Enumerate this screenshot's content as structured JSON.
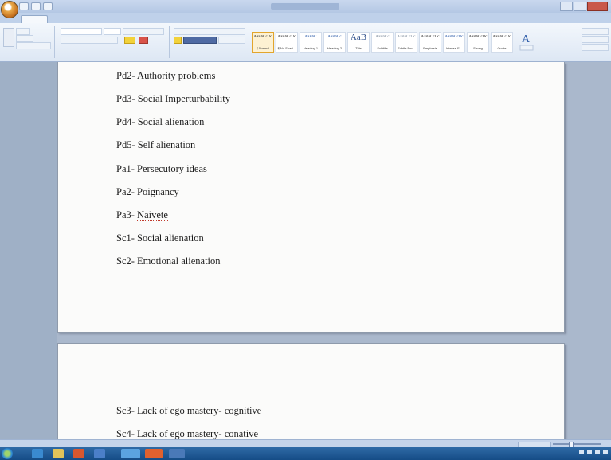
{
  "document": {
    "page1_lines": [
      "Pd2- Authority problems",
      "Pd3- Social Imperturbability",
      "Pd4- Social alienation",
      "Pd5- Self alienation",
      "Pa1- Persecutory ideas",
      "Pa2- Poignancy",
      "Pa3- Naivete",
      "Sc1- Social alienation",
      "Sc2- Emotional alienation"
    ],
    "page2_lines": [
      "Sc3- Lack of ego mastery- cognitive",
      "Sc4- Lack of ego mastery- conative"
    ]
  },
  "colors": {
    "ribbon_bg": "#dde7f4",
    "document_bg": "#aab8cc",
    "page_bg": "#fbfbfa",
    "taskbar": "#154c86",
    "spellcheck_underline": "#c0392b"
  },
  "icons": [
    "office-button-icon",
    "save-icon",
    "undo-icon",
    "redo-icon",
    "minimize-icon",
    "maximize-icon",
    "close-icon",
    "paste-icon",
    "change-styles-icon",
    "find-icon",
    "start-icon"
  ]
}
